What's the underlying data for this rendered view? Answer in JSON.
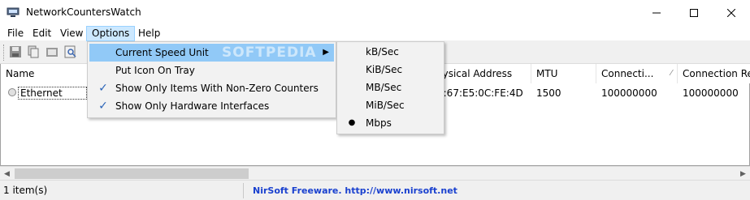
{
  "window": {
    "title": "NetworkCountersWatch",
    "controls": {
      "minimize": "minimize-icon",
      "maximize": "maximize-icon",
      "close": "close-icon"
    }
  },
  "menubar": {
    "items": [
      "File",
      "Edit",
      "View",
      "Options",
      "Help"
    ],
    "active": "Options"
  },
  "toolbar": {
    "icons": [
      "save-icon",
      "copy-icon",
      "properties-icon",
      "find-icon"
    ]
  },
  "list": {
    "columns": [
      "Name",
      "hysical Address",
      "MTU",
      "Connecti...",
      "Connection Re..."
    ],
    "rows": [
      {
        "name": "Ethernet",
        "physical_address": "0:67:E5:0C:FE:4D",
        "mtu": "1500",
        "connection": "100000000",
        "connection_re": "100000000"
      }
    ]
  },
  "options_menu": {
    "items": [
      {
        "label": "Current Speed Unit",
        "checked": false,
        "submenu": true,
        "highlighted": true
      },
      {
        "label": "Put Icon On Tray",
        "checked": false
      },
      {
        "label": "Show Only Items With Non-Zero Counters",
        "checked": true
      },
      {
        "label": "Show Only Hardware Interfaces",
        "checked": true
      }
    ]
  },
  "speed_unit_menu": {
    "items": [
      "kB/Sec",
      "KiB/Sec",
      "MB/Sec",
      "MiB/Sec",
      "Mbps"
    ],
    "selected": "Mbps"
  },
  "watermark": "SOFTPEDIA",
  "status": {
    "items_count": "1 item(s)",
    "link": "NirSoft Freeware.  http://www.nirsoft.net"
  },
  "colors": {
    "menu_active_bg": "#cce8ff",
    "menu_highlight_bg": "#91c9f7",
    "link": "#1a41cf",
    "check": "#2a64b8"
  }
}
